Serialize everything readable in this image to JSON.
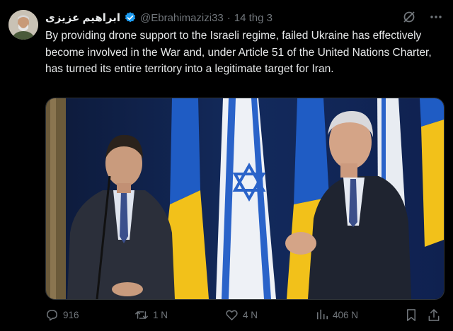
{
  "tweet": {
    "author_name": "ابراهیم عزیزی",
    "handle": "@Ebrahimazizi33",
    "separator": "·",
    "time": "14 thg 3",
    "text": "By providing drone support to the Israeli regime, failed Ukraine has effectively become involved in the War and, under Article 51 of the United Nations Charter, has turned its entire territory into a legitimate target for Iran.",
    "verified": true
  },
  "actions": {
    "replies": "916",
    "reposts": "1 N",
    "likes": "4 N",
    "views": "406 N"
  },
  "icons": [
    "verified-badge-icon",
    "grok-icon",
    "more-icon",
    "reply-icon",
    "repost-icon",
    "like-icon",
    "views-icon",
    "bookmark-icon",
    "share-icon"
  ],
  "colors": {
    "background": "#000000",
    "text": "#e7e9ea",
    "secondary": "#71767b",
    "verified": "#1d9bf0"
  }
}
